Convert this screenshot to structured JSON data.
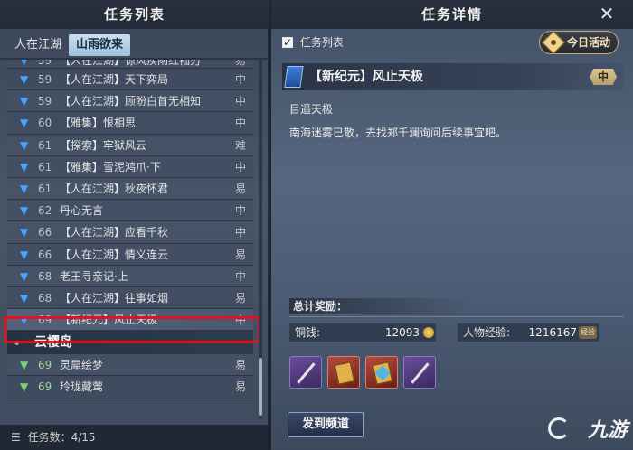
{
  "left": {
    "title": "任务列表",
    "tabs": [
      {
        "label": "人在江湖",
        "active": false
      },
      {
        "label": "山雨欲来",
        "active": true
      }
    ],
    "rows": [
      {
        "level": "59",
        "name": "【人在江湖】惊风疾雨红袖刃",
        "diff": "易",
        "partial": true
      },
      {
        "level": "59",
        "name": "【人在江湖】天下弈局",
        "diff": "中"
      },
      {
        "level": "59",
        "name": "【人在江湖】顾盼白首无相知",
        "diff": "中"
      },
      {
        "level": "60",
        "name": "【雅集】恨相思",
        "diff": "中"
      },
      {
        "level": "61",
        "name": "【探索】牢狱风云",
        "diff": "难"
      },
      {
        "level": "61",
        "name": "【雅集】雪泥鸿爪·下",
        "diff": "中"
      },
      {
        "level": "61",
        "name": "【人在江湖】秋夜怀君",
        "diff": "易"
      },
      {
        "level": "62",
        "name": "丹心无言",
        "diff": "中"
      },
      {
        "level": "66",
        "name": "【人在江湖】应看千秋",
        "diff": "中"
      },
      {
        "level": "66",
        "name": "【人在江湖】情义连云",
        "diff": "易"
      },
      {
        "level": "68",
        "name": "老王寻亲记·上",
        "diff": "中"
      },
      {
        "level": "68",
        "name": "【人在江湖】往事如烟",
        "diff": "易"
      },
      {
        "level": "69",
        "name": "【新纪元】风止天极",
        "diff": "中",
        "selected": true
      }
    ],
    "group": {
      "label": "云樱岛"
    },
    "group_rows": [
      {
        "level": "69",
        "name": "灵犀绘梦",
        "diff": "易"
      },
      {
        "level": "69",
        "name": "玲珑藏莺",
        "diff": "易"
      }
    ],
    "footer": {
      "label": "任务数：4/15"
    }
  },
  "right": {
    "title": "任务详情",
    "close_icon": "close-icon",
    "checkbox_label": "任务列表",
    "today_label": "今日活动",
    "quest": {
      "title": "【新纪元】风止天极",
      "difficulty": "中",
      "objective": "目遥天极",
      "description": "南海迷雾已散，去找郑千澜询问后续事宜吧。"
    },
    "rewards": {
      "label": "总计奖励：",
      "money_label": "铜钱:",
      "money_value": "12093",
      "exp_label": "人物经验:",
      "exp_value": "1216167",
      "exp_badge": "经验",
      "items": [
        "sword-item-icon",
        "book-item-icon",
        "scroll-gem-item-icon",
        "blade-item-icon"
      ]
    },
    "send_label": "发到频道",
    "watermark": "九游"
  },
  "colors": {
    "chevron": "#4aa3ff",
    "highlight": "#e8101a",
    "gold": "#c9a86a"
  }
}
